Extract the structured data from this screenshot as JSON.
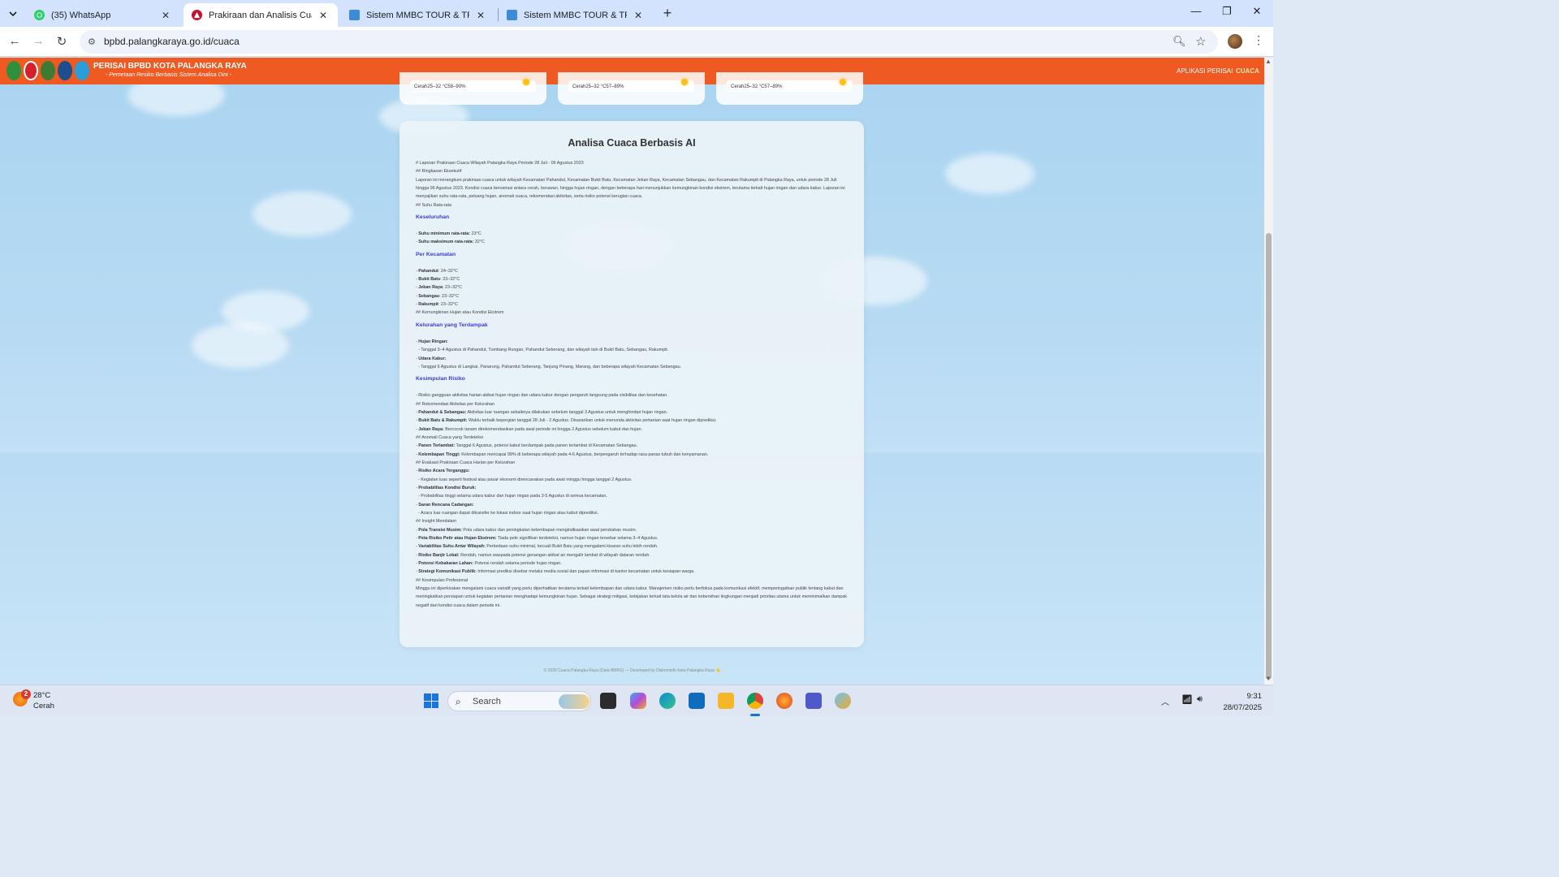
{
  "browser": {
    "tabs": [
      {
        "title": "(35) WhatsApp"
      },
      {
        "title": "Prakiraan dan Analisis Cuaca Ko"
      },
      {
        "title": "Sistem MMBC TOUR & TRAVEL"
      },
      {
        "title": "Sistem MMBC TOUR & TRAVEL"
      }
    ],
    "url": "bpbd.palangkaraya.go.id/cuaca"
  },
  "site": {
    "brand_title": "PERISAI BPBD KOTA PALANGKA RAYA",
    "brand_subtitle": "- Pemetaan Resiko Berbasis Sistem Analisa Dini -",
    "nav": {
      "app": "APLIKASI PERISAI",
      "cuaca": "CUACA"
    },
    "mini_cards": [
      {
        "text": "Cerah25–32 °C58–90%"
      },
      {
        "text": "Cerah25–32 °C57–89%"
      },
      {
        "text": "Cerah25–32 °C57–89%"
      }
    ]
  },
  "analysis": {
    "title": "Analisa Cuaca Berbasis AI",
    "intro_heading": "# Laporan Prakiraan Cuaca Wilayah Palangka Raya Periode 28 Juli - 06 Agustus 2023",
    "exec_heading": "## Ringkasan Eksekutif",
    "exec_text": "Laporan ini merangkum prakiraan cuaca untuk wilayah Kecamatan Pahandut, Kecamatan Bukit Batu, Kecamatan Jekan Raya, Kecamatan Sebangau, dan Kecamatan Rakumpit di Palangka Raya, untuk periode 28 Juli hingga 06 Agustus 2023. Kondisi cuaca bervariasi antara cerah, berawan, hingga hujan ringan, dengan beberapa hari menunjukkan kemungkinan kondisi ekstrem, terutama terkait hujan ringan dan udara kabur. Laporan ini menyajikan suhu rata-rata, peluang hujan, anomali cuaca, rekomendasi aktivitas, serta risiko potensi kerugian cuaca.",
    "suhu_heading": "## Suhu Rata-rata",
    "keseluruhan_heading": "Keseluruhan",
    "suhu_min_label": "Suhu minimum rata-rata:",
    "suhu_min_value": " 23°C",
    "suhu_max_label": "Suhu maksimum rata-rata:",
    "suhu_max_value": " 32°C",
    "per_kecamatan_heading": "Per Kecamatan",
    "kecamatan": [
      {
        "name": "Pahandut",
        "value": ": 24–32°C"
      },
      {
        "name": "Bukit Batu",
        "value": ": 23–32°C"
      },
      {
        "name": "Jekan Raya",
        "value": ": 23–32°C"
      },
      {
        "name": "Sebangau",
        "value": ": 23–32°C"
      },
      {
        "name": "Rakumpit",
        "value": ": 23–32°C"
      }
    ],
    "ekstrem_heading": "## Kemungkinan Hujan atau Kondisi Ekstrem",
    "kelurahan_heading": "Kelurahan yang Terdampak",
    "hujan_label": "Hujan Ringan:",
    "hujan_text": "  - Tanggal 3–4 Agustus di Pahandut, Tumbang Rungan, Pahandut Seberang, dan wilayah lain di Bukit Batu, Sebangau, Rakumpit.",
    "kabur_label": "Udara Kabur:",
    "kabur_text": "  - Tanggal 6 Agustus di Langkai, Panarung, Pahandut Seberang, Tanjung Pinang, Marang, dan beberapa wilayah Kecamatan Sebangau.",
    "kesimpulan_heading": "Kesimpulan Risiko",
    "risiko_text": "- Risiko gangguan aktivitas harian akibat hujan ringan dan udara kabur dengan pengaruh langsung pada visibilitas dan kesehatan.",
    "rekom_heading": "## Rekomendasi Aktivitas per Kelurahan",
    "rekom": [
      {
        "label": "Pahandut & Sebangau:",
        "text": " Aktivitas luar ruangan sebaiknya dilakukan sebelum tanggal 3 Agustus untuk menghindari hujan ringan."
      },
      {
        "label": "Bukit Batu & Rakumpit:",
        "text": " Waktu terbaik bepergian tanggal 28 Juli - 2 Agustus. Disarankan untuk menunda aktivitas pertanian saat hujan ringan diprediksi."
      },
      {
        "label": "Jekan Raya:",
        "text": " Bercocok tanam direkomendasikan pada awal periode ini hingga 2 Agustus sebelum kabut dan hujan."
      }
    ],
    "anomali_heading": "## Anomali Cuaca yang Terdeteksi",
    "anomali": [
      {
        "label": "Panen Terlambat:",
        "text": " Tanggal 6 Agustus, potensi kabut berdampak pada panen terlambat di Kecamatan Sebangau."
      },
      {
        "label": "Kelembapan Tinggi:",
        "text": " Kelembapan mencapai 99% di beberapa wilayah pada 4-6 Agustus, berpengaruh terhadap rasa panas tubuh dan kenyamanan."
      }
    ],
    "evaluasi_heading": "## Evaluasi Prakiraan Cuaca Harian per Kelurahan",
    "evaluasi": [
      {
        "label": "Risiko Acara Terganggu:",
        "text": "  - Kegiatan luas seperti festival atau pasar ekonomi direncanakan pada awal minggu hingga tanggal 2 Agustus."
      },
      {
        "label": "Probabilitas Kondisi Buruk:",
        "text": "  - Probabilitas tinggi selama udara kabur dan hujan ringan pada 3-5 Agustus di semua kecamatan."
      },
      {
        "label": "Saran Rencana Cadangan:",
        "text": "  - Acara luar ruangan dapat ditransfer ke lokasi indoor saat hujan ringan atau kabut diprediksi."
      }
    ],
    "insight_heading": "## Insight Mendalam",
    "insight": [
      {
        "label": "Pola Transisi Musim:",
        "text": " Pola udara kabur dan peningkatan kelembapan mengindikasikan awal perubahan musim."
      },
      {
        "label": "Peta Risiko Petir atau Hujan Ekstrem:",
        "text": " Tiada petir signifikan terdeteksi, namun hujan ringan tersebar selama 3–4 Agustus."
      },
      {
        "label": "Variabilitas Suhu Antar Wilayah:",
        "text": " Perbedaan suhu minimal, kecuali Bukit Batu yang mengalami kisaran suhu lebih rendah."
      },
      {
        "label": "Risiko Banjir Lokal:",
        "text": " Rendah, namun waspada potensi genangan akibat air mengalir lambat di wilayah dataran rendah."
      },
      {
        "label": "Potensi Kebakaran Lahan:",
        "text": " Potensi rendah selama periode hujan ringan."
      },
      {
        "label": "Strategi Komunikasi Publik:",
        "text": " Informasi prediksi disebar melalui media sosial dan papan informasi di kantor kecamatan untuk kesiapan warga."
      }
    ],
    "profesional_heading": "## Kesimpulan Profesional",
    "profesional_text": "Minggu ini diperkirakan mengalami cuaca variatif yang perlu diperhatikan terutama terkait kelembapan dan udara kabur. Manajemen risiko perlu berfokus pada komunikasi efektif, memperingatkan publik tentang kabut dan meningkatkan persiapan untuk kegiatan pertanian menghadapi kemungkinan hujan. Sebagai strategi mitigasi, kebijakan terkait tata kelola air dan kebersihan lingkungan menjadi prioritas utama untuk meminimalkan dampak negatif dari kondisi cuaca dalam periode ini."
  },
  "footer": "© 2025 Cuaca Palangka Raya (Data BMKG) — Developed by Diskominfo Kota Palangka Raya 👈",
  "taskbar": {
    "weather_temp": "28°C",
    "weather_condition": "Cerah",
    "weather_badge": "2",
    "search_label": "Search",
    "time": "9:31",
    "date": "28/07/2025"
  },
  "colors": {
    "header": "#ee5a22",
    "accent_heading": "#3b3bd0"
  },
  "icons": [
    "whatsapp-icon",
    "bpbd-icon",
    "mmbc-icon",
    "search-icon",
    "star-icon",
    "zoom-icon",
    "windows-icon",
    "wifi-icon",
    "volume-icon"
  ]
}
